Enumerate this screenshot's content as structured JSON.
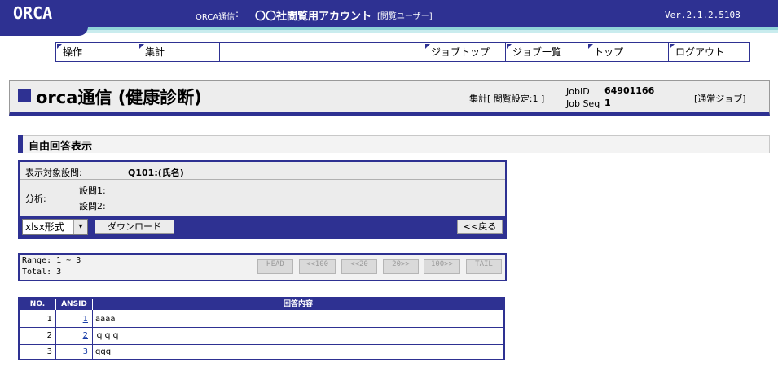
{
  "header": {
    "logo": "ORCA",
    "app_name": "ORCA通信",
    "separator": ":",
    "account": "〇〇社閲覧用アカウント",
    "role": "[閲覧ユーザー]",
    "version": "Ver.2.1.2.5108"
  },
  "nav": {
    "items": [
      {
        "label": "操作"
      },
      {
        "label": "集計"
      },
      {
        "label": ""
      },
      {
        "label": "ジョブトップ"
      },
      {
        "label": "ジョブ一覧"
      },
      {
        "label": "トップ"
      },
      {
        "label": "ログアウト"
      }
    ]
  },
  "title": {
    "text": "orca通信 (健康診断)",
    "tally": "集計[ 閲覧設定:1 ]",
    "job_id_label": "JobID",
    "job_id_value": "64901166",
    "job_seq_label": "Job Seq",
    "job_seq_value": "1",
    "job_type": "[通常ジョブ]"
  },
  "section": {
    "title": "自由回答表示"
  },
  "query": {
    "target_label": "表示対象設問:",
    "target_value": "Q101:(氏名)",
    "analysis_label": "分析:",
    "q1_label": "設問1:",
    "q2_label": "設問2:",
    "format_selected": "xlsx形式",
    "download_label": "ダウンロード",
    "back_label": "<<戻る"
  },
  "paging": {
    "range": "Range: 1 ~ 3",
    "total": "Total: 3",
    "buttons": [
      "HEAD",
      "<<100",
      "<<20",
      "20>>",
      "100>>",
      "TAIL"
    ]
  },
  "table": {
    "headers": [
      "NO.",
      "ANSID",
      "回答内容"
    ],
    "rows": [
      {
        "no": "1",
        "ansid": "1",
        "content": "aaaa"
      },
      {
        "no": "2",
        "ansid": "2",
        "content": "ｑｑｑ"
      },
      {
        "no": "3",
        "ansid": "3",
        "content": "qqq"
      }
    ]
  },
  "colors": {
    "brand": "#2e3192",
    "stripe": "#8fd3d8"
  }
}
